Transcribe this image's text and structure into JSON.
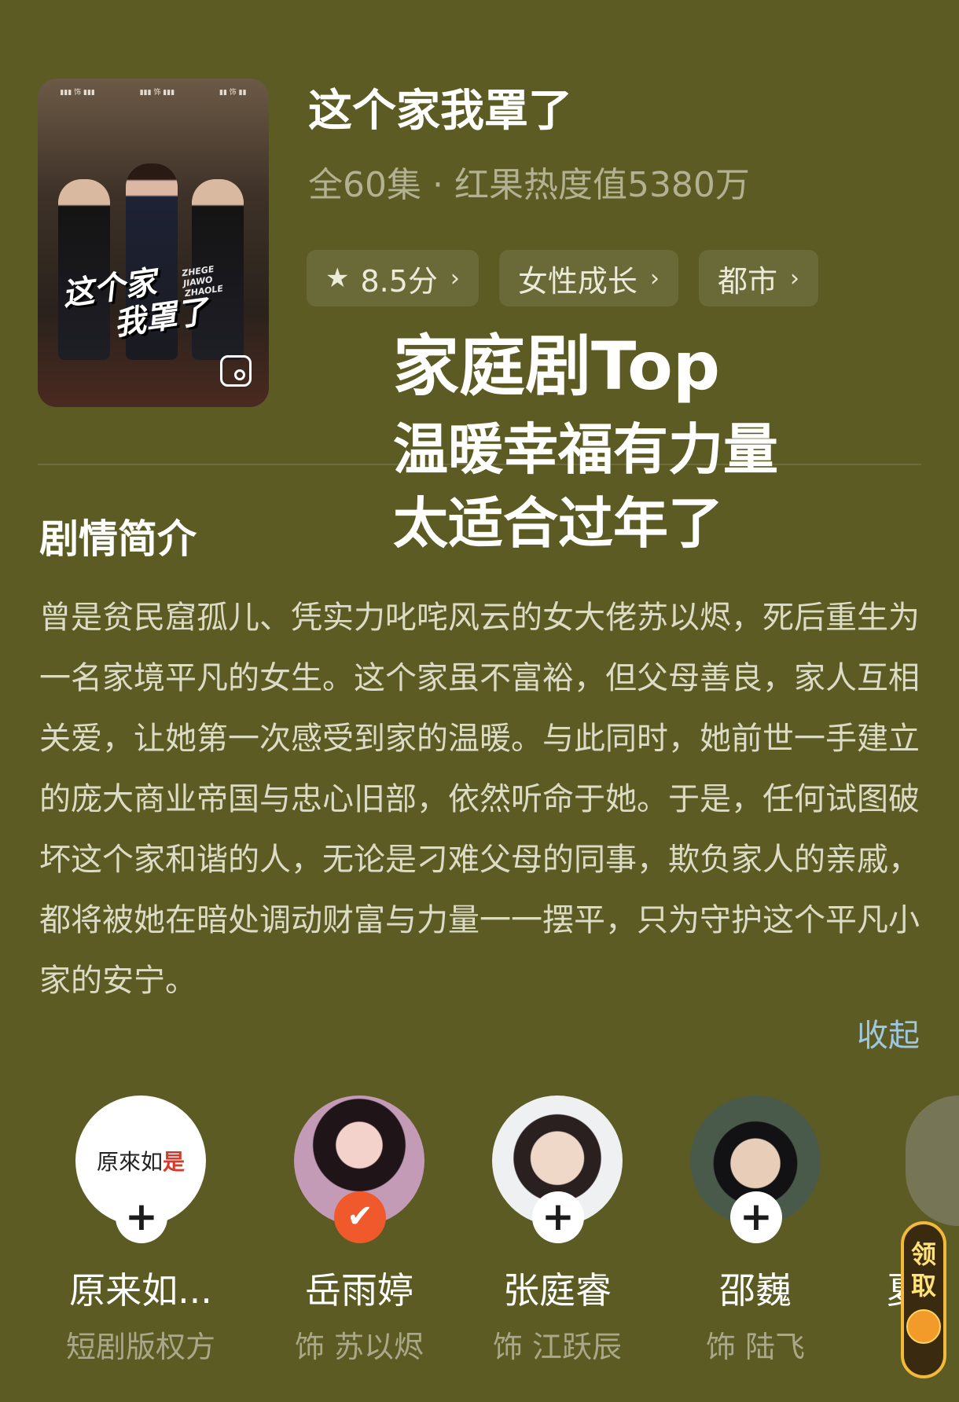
{
  "drama": {
    "title": "这个家我罩了",
    "meta": "全60集 · 红果热度值5380万",
    "poster": {
      "title_line1": "这个家",
      "title_line2": "我罩了",
      "subtitle_line1": "ZHEGE",
      "subtitle_line2": "JIAWO",
      "subtitle_line3": "ZHAOLE",
      "icon": "gallery-icon"
    },
    "tags": [
      {
        "label": "8.5分",
        "icon": "star-icon"
      },
      {
        "label": "女性成长"
      },
      {
        "label": "都市"
      }
    ]
  },
  "overlay": {
    "line1": "家庭剧Top",
    "line2": "温暖幸福有力量",
    "line3": "太适合过年了"
  },
  "synopsis": {
    "heading": "剧情简介",
    "text": "曾是贫民窟孤儿、凭实力叱咤风云的女大佬苏以烬，死后重生为一名家境平凡的女生。这个家虽不富裕，但父母善良，家人互相关爱，让她第一次感受到家的温暖。与此同时，她前世一手建立的庞大商业帝国与忠心旧部，依然听命于她。于是，任何试图破坏这个家和谐的人，无论是刁难父母的同事，欺负家人的亲戚，都将被她在暗处调动财富与力量一一摆平，只为守护这个平凡小家的安宁。",
    "collapse_label": "收起"
  },
  "cast": [
    {
      "name": "原来如...",
      "role": "短剧版权方",
      "logo_text": "原來如",
      "logo_accent": "是",
      "followed": false
    },
    {
      "name": "岳雨婷",
      "role": "饰 苏以烬",
      "followed": true
    },
    {
      "name": "张庭睿",
      "role": "饰 江跃辰",
      "followed": false
    },
    {
      "name": "邵巍",
      "role": "饰 陆飞",
      "followed": false
    }
  ],
  "cast_partial_name": "夏",
  "claim_button": {
    "label_1": "领",
    "label_2": "取"
  },
  "colors": {
    "background": "#5b5b23",
    "tag_bg": "#6a6a38",
    "follow_active": "#f0592b",
    "link": "#9fc7e0",
    "claim_border": "#f3b93a"
  }
}
